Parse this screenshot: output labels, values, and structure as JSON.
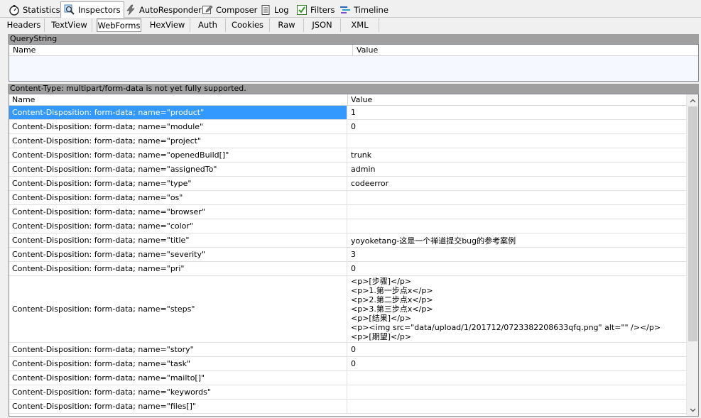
{
  "top_tabs": [
    {
      "label": "Statistics",
      "icon": "stopwatch-icon"
    },
    {
      "label": "Inspectors",
      "icon": "magnifier-icon"
    },
    {
      "label": "AutoResponder",
      "icon": "lightning-icon"
    },
    {
      "label": "Composer",
      "icon": "pencil-icon"
    },
    {
      "label": "Log",
      "icon": "log-icon"
    },
    {
      "label": "Filters",
      "icon": "checkbox-icon"
    },
    {
      "label": "Timeline",
      "icon": "timeline-icon"
    }
  ],
  "sub_tabs": [
    "Headers",
    "TextView",
    "WebForms",
    "HexView",
    "Auth",
    "Cookies",
    "Raw",
    "JSON",
    "XML"
  ],
  "querystring": {
    "title": "QueryString",
    "col_name": "Name",
    "col_value": "Value"
  },
  "body": {
    "title": "Content-Type: multipart/form-data is not yet fully supported.",
    "col_name": "Name",
    "col_value": "Value",
    "rows": [
      {
        "name": "Content-Disposition: form-data; name=\"product\"",
        "value": "1"
      },
      {
        "name": "Content-Disposition: form-data; name=\"module\"",
        "value": "0"
      },
      {
        "name": "Content-Disposition: form-data; name=\"project\"",
        "value": ""
      },
      {
        "name": "Content-Disposition: form-data; name=\"openedBuild[]\"",
        "value": "trunk"
      },
      {
        "name": "Content-Disposition: form-data; name=\"assignedTo\"",
        "value": "admin"
      },
      {
        "name": "Content-Disposition: form-data; name=\"type\"",
        "value": "codeerror"
      },
      {
        "name": "Content-Disposition: form-data; name=\"os\"",
        "value": ""
      },
      {
        "name": "Content-Disposition: form-data; name=\"browser\"",
        "value": ""
      },
      {
        "name": "Content-Disposition: form-data; name=\"color\"",
        "value": ""
      },
      {
        "name": "Content-Disposition: form-data; name=\"title\"",
        "value": "yoyoketang-这是一个禅道提交bug的参考案例"
      },
      {
        "name": "Content-Disposition: form-data; name=\"severity\"",
        "value": "3"
      },
      {
        "name": "Content-Disposition: form-data; name=\"pri\"",
        "value": "0"
      },
      {
        "name": "Content-Disposition: form-data; name=\"steps\"",
        "value_lines": [
          "<p>[步骤]</p>",
          "<p>1.第一步点x</p>",
          "<p>2.第二步点x</p>",
          "<p>3.第三步点x</p>",
          "<p>[结果]</p>",
          "<p><img src=\"data/upload/1/201712/0723382208633qfq.png\" alt=\"\" /></p>",
          "<p>[期望]</p>"
        ]
      },
      {
        "name": "Content-Disposition: form-data; name=\"story\"",
        "value": "0"
      },
      {
        "name": "Content-Disposition: form-data; name=\"task\"",
        "value": "0"
      },
      {
        "name": "Content-Disposition: form-data; name=\"mailto[]\"",
        "value": ""
      },
      {
        "name": "Content-Disposition: form-data; name=\"keywords\"",
        "value": ""
      },
      {
        "name": "Content-Disposition: form-data; name=\"files[]\"",
        "value": ""
      }
    ]
  },
  "colors": {
    "selection": "#3399ff",
    "section_bar": "#a0a0a0"
  }
}
